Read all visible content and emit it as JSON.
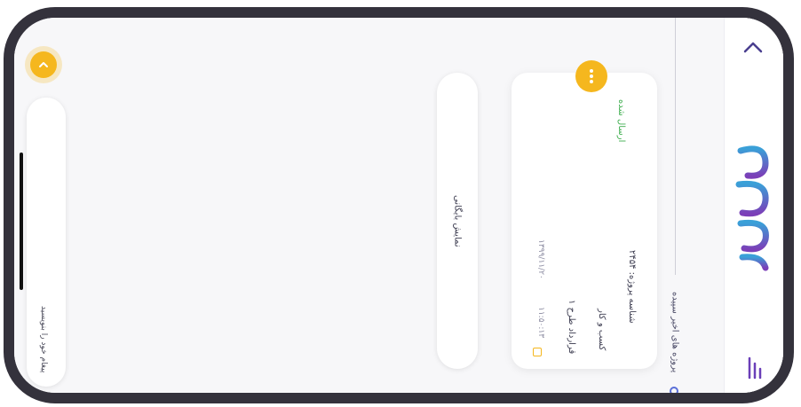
{
  "sidebar": {
    "collapse_icon": "chevron-up-icon",
    "logo_icon": "brand-logo-icon",
    "menu_icon": "menu-icon"
  },
  "projects_header": {
    "title": "پروژه های اخیر سپیده"
  },
  "project_card": {
    "status": "ارسال شده",
    "project_id": "شناسه پروژه: ۲۴۵۴",
    "category": "کسب و کار",
    "subject": "قرارداد طرح ۱",
    "date": "۱۳۹۹/۱۱/۲۰",
    "time": "۱۱:۵۰:۱۳",
    "more_icon": "more-vertical-icon",
    "calendar_icon": "calendar-icon"
  },
  "show_all_button": {
    "label": "نمایش بایگانی"
  },
  "left_panel": {
    "text": "پیغام خود را بنویسید"
  },
  "fab": {
    "icon": "chevron-up-icon"
  },
  "colors": {
    "accent": "#f5b71e",
    "success": "#3fae4f",
    "frame": "#34323c",
    "brand_purple": "#6a3fb8"
  }
}
